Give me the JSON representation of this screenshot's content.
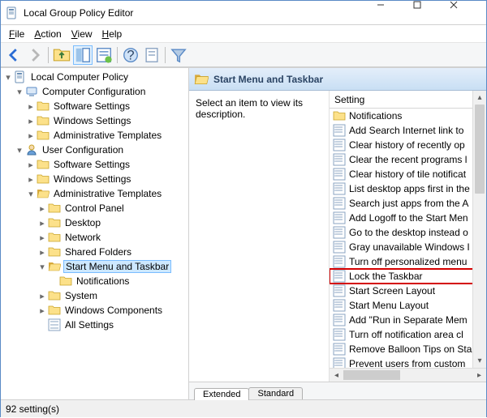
{
  "window": {
    "title": "Local Group Policy Editor"
  },
  "menubar": {
    "items": [
      "File",
      "Action",
      "View",
      "Help"
    ]
  },
  "tree": {
    "root": {
      "label": "Local Computer Policy"
    },
    "computer": {
      "label": "Computer Configuration",
      "children": [
        "Software Settings",
        "Windows Settings",
        "Administrative Templates"
      ]
    },
    "user": {
      "label": "User Configuration",
      "children_top": [
        "Software Settings",
        "Windows Settings"
      ],
      "admin": {
        "label": "Administrative Templates",
        "children_top": [
          "Control Panel",
          "Desktop",
          "Network",
          "Shared Folders"
        ],
        "selected": {
          "label": "Start Menu and Taskbar",
          "child": "Notifications"
        },
        "children_bottom": [
          "System",
          "Windows Components",
          "All Settings"
        ]
      }
    }
  },
  "pane": {
    "title": "Start Menu and Taskbar",
    "description": "Select an item to view its description.",
    "column": "Setting",
    "highlighted": "Lock the Taskbar",
    "items": [
      {
        "label": "Notifications",
        "type": "folder"
      },
      {
        "label": "Add Search Internet link to",
        "type": "setting"
      },
      {
        "label": "Clear history of recently op",
        "type": "setting"
      },
      {
        "label": "Clear the recent programs l",
        "type": "setting"
      },
      {
        "label": "Clear history of tile notificat",
        "type": "setting"
      },
      {
        "label": "List desktop apps first in the",
        "type": "setting"
      },
      {
        "label": "Search just apps from the A",
        "type": "setting"
      },
      {
        "label": "Add Logoff to the Start Men",
        "type": "setting"
      },
      {
        "label": "Go to the desktop instead o",
        "type": "setting"
      },
      {
        "label": "Gray unavailable Windows I",
        "type": "setting"
      },
      {
        "label": "Turn off personalized menu",
        "type": "setting"
      },
      {
        "label": "Lock the Taskbar",
        "type": "setting"
      },
      {
        "label": "Start Screen Layout",
        "type": "setting"
      },
      {
        "label": "Start Menu Layout",
        "type": "setting"
      },
      {
        "label": "Add \"Run in Separate Mem",
        "type": "setting"
      },
      {
        "label": "Turn off notification area cl",
        "type": "setting"
      },
      {
        "label": "Remove Balloon Tips on Sta",
        "type": "setting"
      },
      {
        "label": "Prevent users from custom",
        "type": "setting"
      }
    ]
  },
  "tabs": {
    "extended": "Extended",
    "standard": "Standard"
  },
  "statusbar": {
    "text": "92 setting(s)"
  }
}
